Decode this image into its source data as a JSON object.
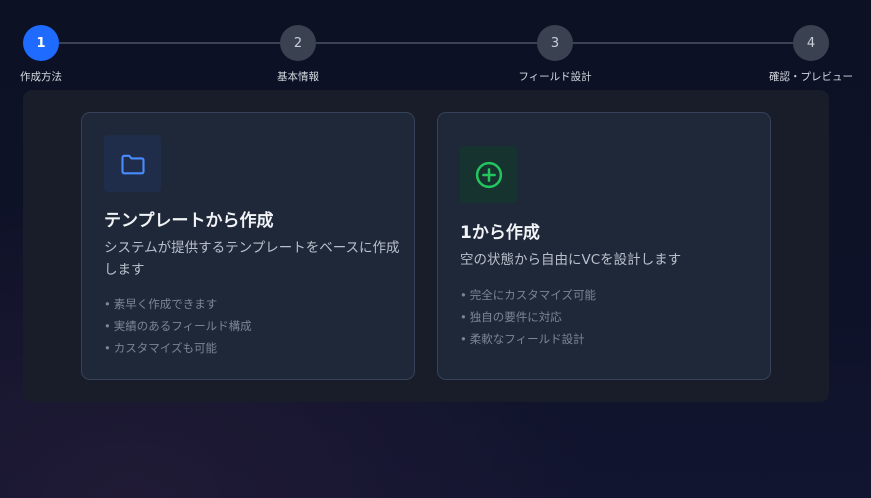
{
  "stepper": {
    "steps": [
      {
        "number": "1",
        "label": "作成方法",
        "active": true
      },
      {
        "number": "2",
        "label": "基本情報",
        "active": false
      },
      {
        "number": "3",
        "label": "フィールド設計",
        "active": false
      },
      {
        "number": "4",
        "label": "確認・プレビュー",
        "active": false
      }
    ]
  },
  "options": {
    "template": {
      "icon": "folder-icon",
      "title": "テンプレートから作成",
      "description": "システムが提供するテンプレートをベースに作成します",
      "features": [
        "素早く作成できます",
        "実績のあるフィールド構成",
        "カスタマイズも可能"
      ]
    },
    "scratch": {
      "icon": "plus-circle-icon",
      "title": "1から作成",
      "description": "空の状態から自由にVCを設計します",
      "features": [
        "完全にカスタマイズ可能",
        "独自の要件に対応",
        "柔軟なフィールド設計"
      ]
    }
  },
  "colors": {
    "accent": "#1f6bff",
    "folder_icon": "#4a8cff",
    "plus_icon": "#22c55e"
  }
}
